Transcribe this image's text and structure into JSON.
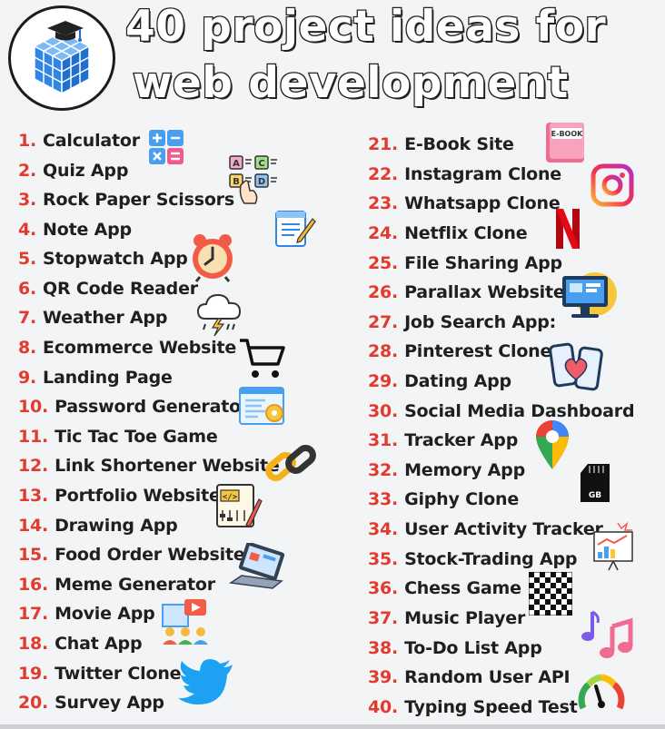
{
  "title": {
    "line1": "40 project ideas for",
    "line2": "web development"
  },
  "left_items": [
    {
      "num": "1.",
      "label": "Calculator",
      "icon": "calculator-icon"
    },
    {
      "num": "2.",
      "label": "Quiz App",
      "icon": "quiz-icon"
    },
    {
      "num": "3.",
      "label": "Rock Paper Scissors"
    },
    {
      "num": "4.",
      "label": "Note App",
      "icon": "notepad-icon"
    },
    {
      "num": "5.",
      "label": "Stopwatch App",
      "icon": "alarm-clock-icon"
    },
    {
      "num": "6.",
      "label": "QR Code Reader"
    },
    {
      "num": "7.",
      "label": "Weather App",
      "icon": "storm-cloud-icon"
    },
    {
      "num": "8.",
      "label": "Ecommerce Website",
      "icon": "shopping-cart-icon"
    },
    {
      "num": "9.",
      "label": "Landing Page"
    },
    {
      "num": "10.",
      "label": "Password Generator",
      "icon": "settings-window-icon"
    },
    {
      "num": "11.",
      "label": "Tic Tac Toe Game"
    },
    {
      "num": "12.",
      "label": "Link Shortener Website",
      "icon": "chain-link-icon"
    },
    {
      "num": "13.",
      "label": "Portfolio Website",
      "icon": "code-board-icon"
    },
    {
      "num": "14.",
      "label": "Drawing App"
    },
    {
      "num": "15.",
      "label": "Food Order Website",
      "icon": "laptop-icon"
    },
    {
      "num": "16.",
      "label": "Meme Generator"
    },
    {
      "num": "17.",
      "label": "Movie App",
      "icon": "video-call-icon"
    },
    {
      "num": "18.",
      "label": "Chat App"
    },
    {
      "num": "19.",
      "label": "Twitter Clone",
      "icon": "twitter-bird-icon"
    },
    {
      "num": "20.",
      "label": "Survey App"
    }
  ],
  "right_items": [
    {
      "num": "21.",
      "label": "E-Book Site",
      "icon": "ebook-icon"
    },
    {
      "num": "22.",
      "label": "Instagram Clone",
      "icon": "instagram-icon"
    },
    {
      "num": "23.",
      "label": "Whatsapp Clone"
    },
    {
      "num": "24.",
      "label": "Netflix Clone",
      "icon": "netflix-icon"
    },
    {
      "num": "25.",
      "label": "File Sharing App"
    },
    {
      "num": "26.",
      "label": "Parallax Website",
      "icon": "desktop-monitor-icon"
    },
    {
      "num": "27.",
      "label": "Job Search App:"
    },
    {
      "num": "28.",
      "label": "Pinterest Clone",
      "icon": "dating-phones-icon"
    },
    {
      "num": "29.",
      "label": "Dating App"
    },
    {
      "num": "30.",
      "label": "Social Media Dashboard"
    },
    {
      "num": "31.",
      "label": "Tracker App",
      "icon": "map-pin-icon"
    },
    {
      "num": "32.",
      "label": "Memory App",
      "icon": "sd-card-icon"
    },
    {
      "num": "33.",
      "label": "Giphy Clone"
    },
    {
      "num": "34.",
      "label": "User Activity Tracker",
      "icon": "analytics-board-icon"
    },
    {
      "num": "35.",
      "label": "Stock-Trading App"
    },
    {
      "num": "36.",
      "label": "Chess Game",
      "icon": "chessboard-icon"
    },
    {
      "num": "37.",
      "label": "Music Player",
      "icon": "music-notes-icon"
    },
    {
      "num": "38.",
      "label": "To-Do List App"
    },
    {
      "num": "39.",
      "label": "Random User API",
      "icon": "speedometer-icon"
    },
    {
      "num": "40.",
      "label": "Typing Speed Test"
    }
  ],
  "icon_labels": {
    "ebook": "E-BOOK",
    "sd_card": "GB"
  },
  "colors": {
    "number": "#e23b2e",
    "text": "#1f1f1f",
    "background": "#f3f4f6",
    "logo_blue": "#2f86e6"
  }
}
